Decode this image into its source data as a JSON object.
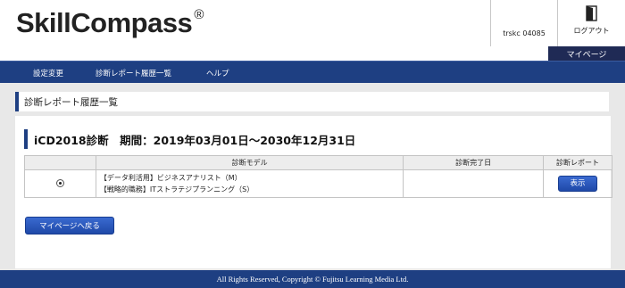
{
  "header": {
    "logo_text": "SkillCompass",
    "logo_mark": "®",
    "user_id": "trskc 04085",
    "logout_label": "ログアウト",
    "logout_icon": "door-exit-icon"
  },
  "mypage_tab": "マイページ",
  "nav": {
    "items": [
      {
        "label": "設定変更"
      },
      {
        "label": "診断レポート履歴一覧"
      },
      {
        "label": "ヘルプ"
      }
    ]
  },
  "page_title": "診断レポート履歴一覧",
  "period_title": "iCD2018診断　期間：2019年03月01日～2030年12月31日",
  "table": {
    "headers": [
      "",
      "診断モデル",
      "診断完了日",
      "診断レポート"
    ],
    "rows": [
      {
        "selected": true,
        "model_lines": [
          "【データ利活用】ビジネスアナリスト（M）",
          "【戦略的職務】ITストラテジプランニング（S）"
        ],
        "completed": "",
        "button_label": "表示"
      }
    ]
  },
  "back_button": "マイページへ戻る",
  "footer": "All Rights Reserved, Copyright © Fujitsu Learning Media Ltd.",
  "colors": {
    "navy": "#1e3f82",
    "dark_tab": "#1f2a55",
    "button_blue": "#2a57bd"
  }
}
